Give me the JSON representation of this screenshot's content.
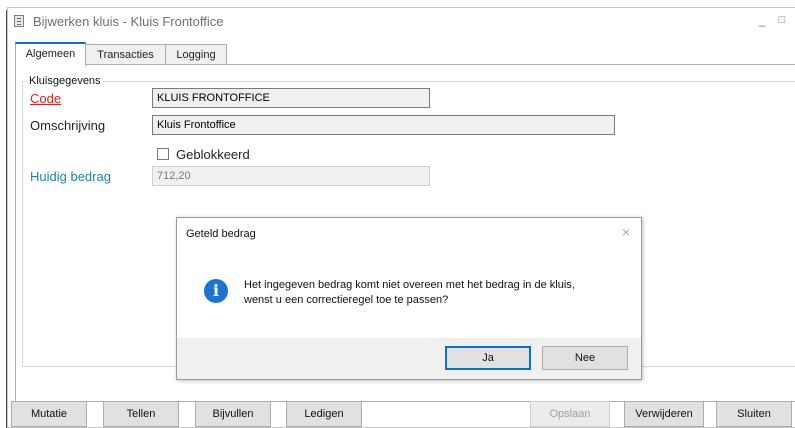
{
  "window": {
    "title": "Bijwerken kluis - Kluis Frontoffice",
    "minimize_glyph": "_",
    "maximize_glyph": "□",
    "close_glyph": "×"
  },
  "tabs": [
    {
      "label": "Algemeen",
      "active": true
    },
    {
      "label": "Transacties",
      "active": false
    },
    {
      "label": "Logging",
      "active": false
    }
  ],
  "form": {
    "group_title": "Kluisgegevens",
    "code_label": "Code",
    "code_value": "KLUIS FRONTOFFICE",
    "omschrijving_label": "Omschrijving",
    "omschrijving_value": "Kluis Frontoffice",
    "geblokkeerd_label": "Geblokkeerd",
    "geblokkeerd_checked": false,
    "huidig_bedrag_label": "Huidig bedrag",
    "huidig_bedrag_value": "712,20"
  },
  "bottom_buttons": {
    "mutatie": "Mutatie",
    "tellen": "Tellen",
    "bijvullen": "Bijvullen",
    "ledigen": "Ledigen",
    "opslaan": "Opslaan",
    "verwijderen": "Verwijderen",
    "sluiten": "Sluiten"
  },
  "dialog": {
    "title": "Geteld bedrag",
    "close_glyph": "×",
    "icon": "info-icon",
    "message_line1": "Het ingegeven bedrag komt niet overeen met het bedrag in de kluis,",
    "message_line2": "wenst u een correctieregel toe te passen?",
    "yes_label": "Ja",
    "no_label": "Nee"
  },
  "colors": {
    "accent": "#0a6fd0",
    "required_label": "#e02020",
    "readonly_label": "#1f84a6",
    "info_icon": "#1f73d0"
  }
}
